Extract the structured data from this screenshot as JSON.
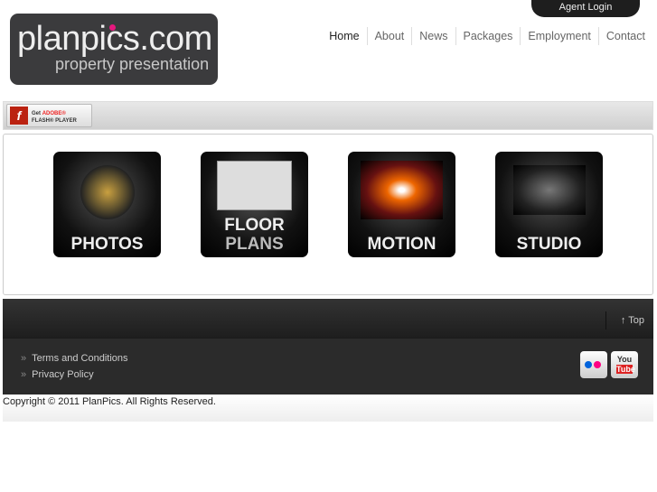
{
  "header": {
    "agent_login": "Agent Login",
    "logo_main": "planpics.com",
    "logo_sub": "property presentation"
  },
  "nav": [
    "Home",
    "About",
    "News",
    "Packages",
    "Employment",
    "Contact"
  ],
  "flash": {
    "line1_prefix": "Get",
    "line1_brand": "ADOBE®",
    "line2": "FLASH® PLAYER"
  },
  "tiles": [
    {
      "label": "PHOTOS"
    },
    {
      "label1": "FLOOR",
      "label2": "PLANS"
    },
    {
      "label": "MOTION"
    },
    {
      "label": "STUDIO"
    }
  ],
  "footer": {
    "top": "Top",
    "links": [
      "Terms and Conditions",
      "Privacy Policy"
    ],
    "youtube_line1": "You",
    "youtube_line2": "Tube"
  },
  "copyright": "Copyright © 2011 PlanPics. All Rights Reserved."
}
